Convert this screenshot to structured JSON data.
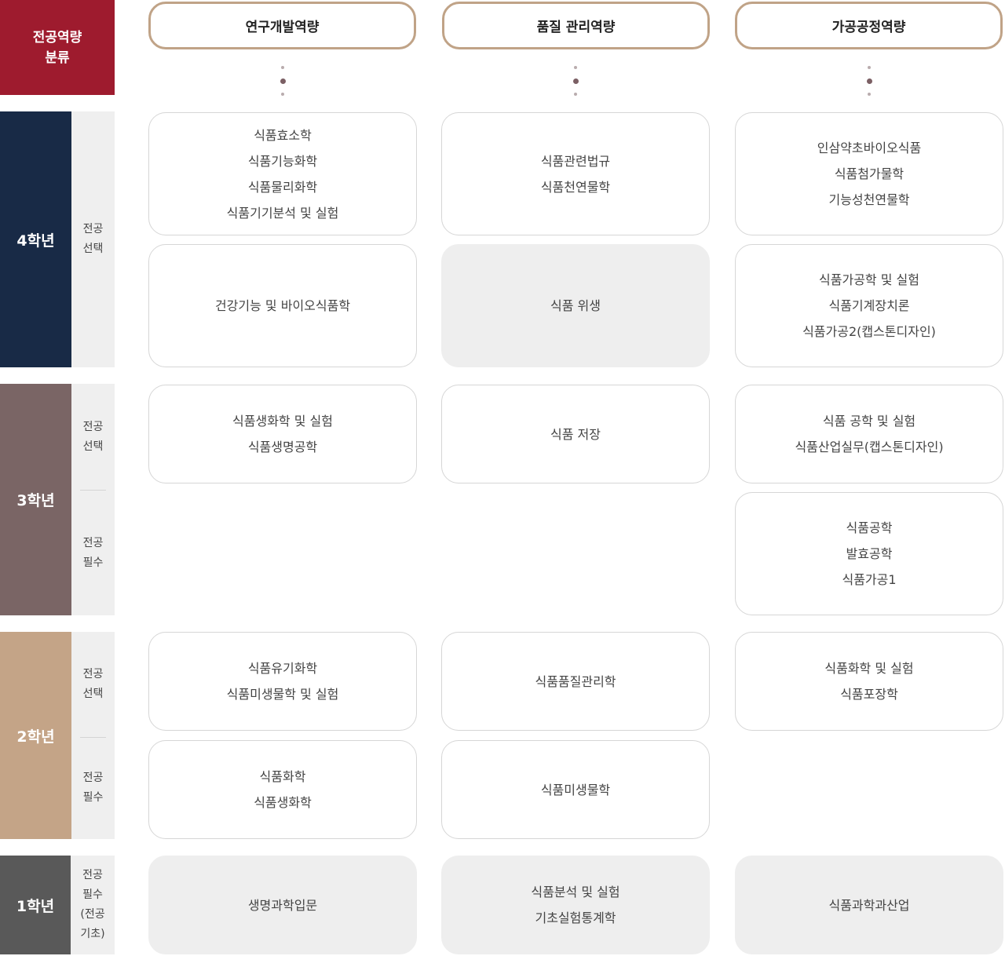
{
  "header": {
    "label_lines": [
      "전공역량",
      "분류"
    ],
    "categories": [
      "연구개발역량",
      "품질 관리역량",
      "가공공정역량"
    ]
  },
  "years": [
    {
      "label": "4학년",
      "color": "#182a46"
    },
    {
      "label": "3학년",
      "color": "#7a6565"
    },
    {
      "label": "2학년",
      "color": "#c4a487"
    },
    {
      "label": "1학년",
      "color": "#595959"
    }
  ],
  "subs": {
    "elective": [
      "전공",
      "선택"
    ],
    "required": [
      "전공",
      "필수"
    ],
    "required_basic": [
      "전공",
      "필수",
      "(전공",
      "기초)"
    ]
  },
  "courses": {
    "y4_rd_elective_a": [
      "식품효소학",
      "식품기능화학",
      "식품물리화학",
      "식품기기분석 및 실험"
    ],
    "y4_rd_elective_b": [
      "건강기능 및 바이오식품학"
    ],
    "y4_qm_elective_a": [
      "식품관련법규",
      "식품천연물학"
    ],
    "y4_qm_required": [
      "식품 위생"
    ],
    "y4_pp_elective_a": [
      "인삼약초바이오식품",
      "식품첨가물학",
      "기능성천연물학"
    ],
    "y4_pp_elective_b": [
      "식품가공학 및 실험",
      "식품기계장치론",
      "식품가공2(캡스톤디자인)"
    ],
    "y3_rd_elective": [
      "식품생화학 및 실험",
      "식품생명공학"
    ],
    "y3_qm_elective": [
      "식품 저장"
    ],
    "y3_pp_elective": [
      "식품 공학 및 실험",
      "식품산업실무(캡스톤디자인)"
    ],
    "y3_pp_required": [
      "식품공학",
      "발효공학",
      "식품가공1"
    ],
    "y2_rd_elective": [
      "식품유기화학",
      "식품미생물학 및 실험"
    ],
    "y2_qm_elective": [
      "식품품질관리학"
    ],
    "y2_pp_elective": [
      "식품화학 및 실험",
      "식품포장학"
    ],
    "y2_rd_required": [
      "식품화학",
      "식품생화학"
    ],
    "y2_qm_required": [
      "식품미생물학"
    ],
    "y1_rd": [
      "생명과학입문"
    ],
    "y1_qm": [
      "식품분석 및 실험",
      "기초실험통계학"
    ],
    "y1_pp": [
      "식품과학과산업"
    ]
  }
}
